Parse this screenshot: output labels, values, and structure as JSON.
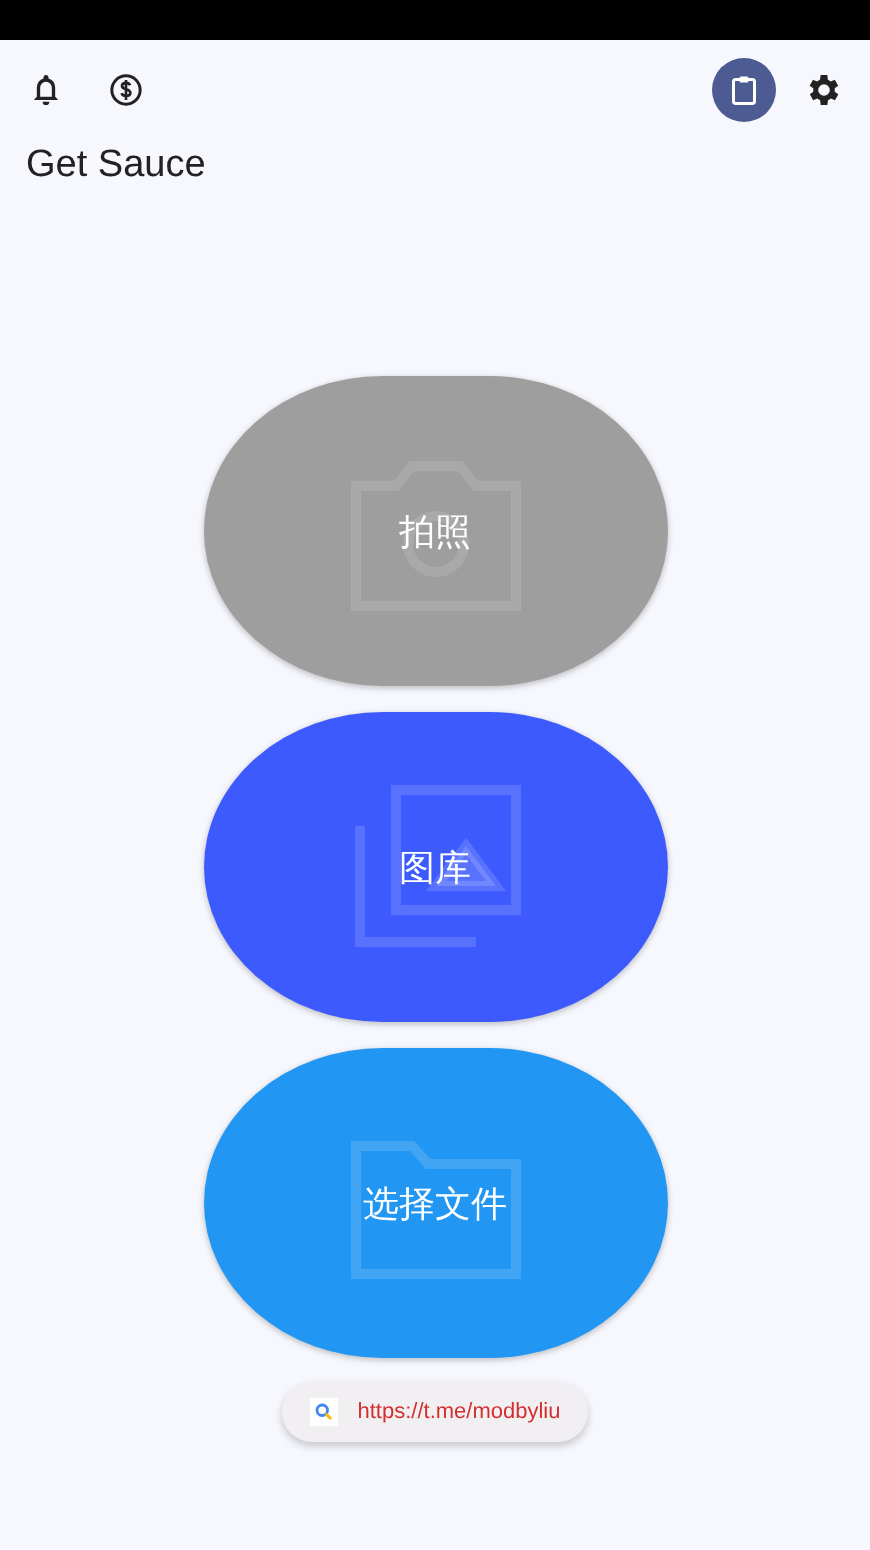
{
  "toolbar": {
    "clipboard_selected": true
  },
  "title": "Get Sauce",
  "actions": [
    {
      "kind": "camera",
      "label": "拍照",
      "color": "#9e9e9e"
    },
    {
      "kind": "gallery",
      "label": "图库",
      "color": "#3d5afe"
    },
    {
      "kind": "folder",
      "label": "选择文件",
      "color": "#2196f3"
    }
  ],
  "link": "https://t.me/modbyliu"
}
